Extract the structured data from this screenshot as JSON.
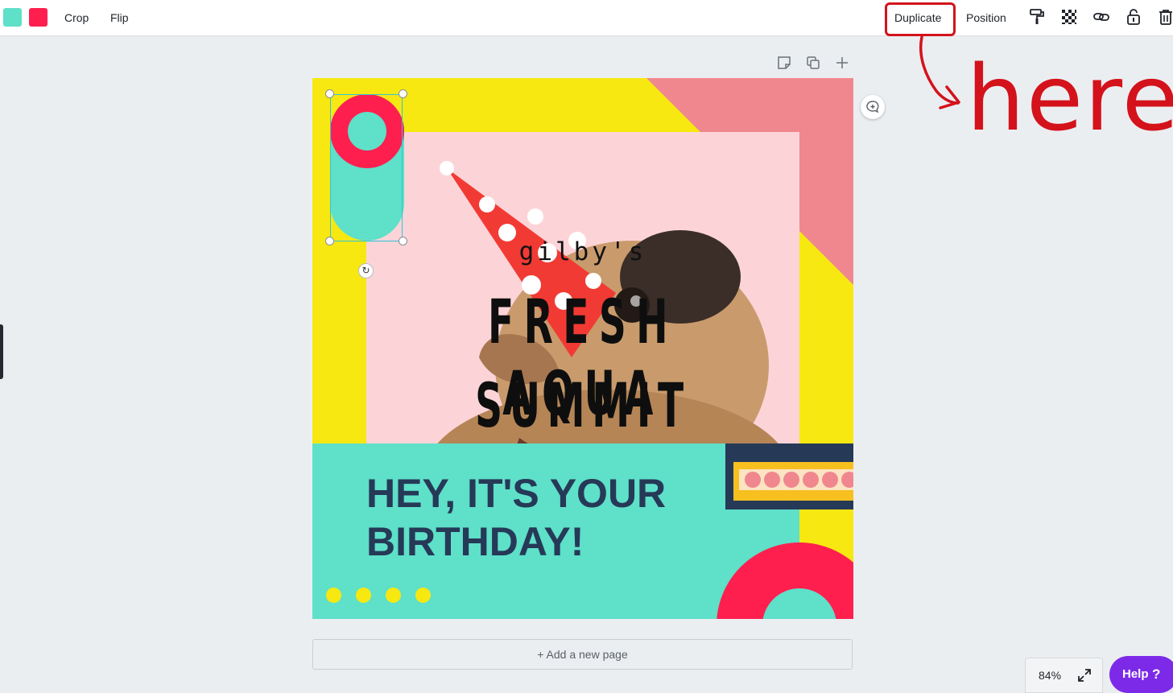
{
  "toolbar": {
    "swatches": [
      {
        "name": "aqua",
        "color": "#5ee0c9"
      },
      {
        "name": "red",
        "color": "#ff1f4f"
      }
    ],
    "crop_label": "Crop",
    "flip_label": "Flip",
    "duplicate_label": "Duplicate",
    "position_label": "Position",
    "icons": [
      "paint-roller-icon",
      "transparency-icon",
      "link-icon",
      "unlock-icon",
      "trash-icon"
    ]
  },
  "annotation": {
    "handwritten_text": "here",
    "color": "#d4121b"
  },
  "design": {
    "brand_text": "gilby's",
    "headline_line1": "FRESH AQUA",
    "headline_line2": "SUMMIT",
    "birthday_line1": "HEY, IT'S YOUR",
    "birthday_line2": "BIRTHDAY!",
    "colors": {
      "yellow": "#f7e811",
      "aqua": "#5ee0c9",
      "red": "#ff1f4f",
      "pink": "#f0878f",
      "navy": "#263957"
    }
  },
  "page_controls": [
    "add-note-icon",
    "duplicate-page-icon",
    "add-page-icon"
  ],
  "add_page_label": "+ Add a new page",
  "zoom": {
    "value": "84%"
  },
  "help": {
    "label": "Help",
    "icon_glyph": "?"
  }
}
